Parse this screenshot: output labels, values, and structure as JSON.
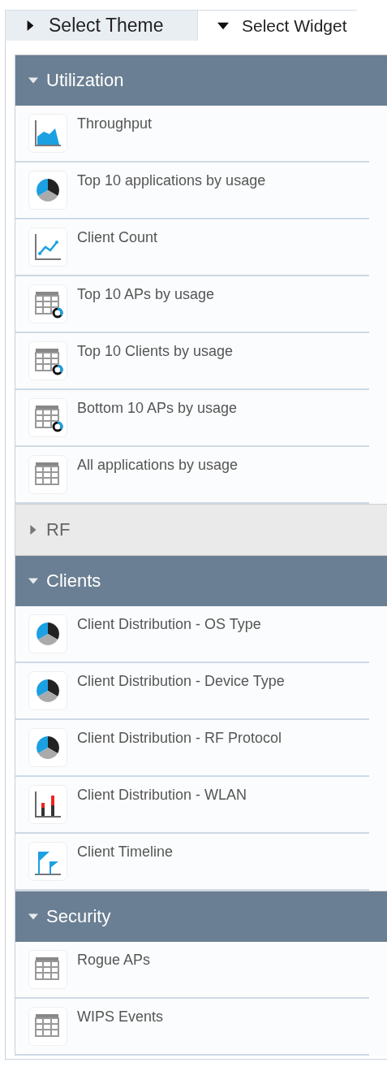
{
  "tabs": [
    {
      "label": "Select Theme",
      "selected": false
    },
    {
      "label": "Select Widget",
      "selected": true
    }
  ],
  "sections": [
    {
      "title": "Utilization",
      "expanded": true,
      "items": [
        {
          "label": "Throughput",
          "kind": "area"
        },
        {
          "label": "Top 10 applications by usage",
          "kind": "pie"
        },
        {
          "label": "Client Count",
          "kind": "line"
        },
        {
          "label": "Top 10 APs by usage",
          "kind": "table-donut"
        },
        {
          "label": "Top 10 Clients by usage",
          "kind": "table-donut"
        },
        {
          "label": "Bottom 10 APs by usage",
          "kind": "table-donut"
        },
        {
          "label": "All applications by usage",
          "kind": "table"
        }
      ]
    },
    {
      "title": "RF",
      "expanded": false
    },
    {
      "title": "Clients",
      "expanded": true,
      "items": [
        {
          "label": "Client Distribution - OS Type",
          "kind": "pie"
        },
        {
          "label": "Client Distribution - Device Type",
          "kind": "pie"
        },
        {
          "label": "Client Distribution - RF Protocol",
          "kind": "pie"
        },
        {
          "label": "Client Distribution - WLAN",
          "kind": "bar"
        },
        {
          "label": "Client Timeline",
          "kind": "flag"
        }
      ]
    },
    {
      "title": "Security",
      "expanded": true,
      "items": [
        {
          "label": "Rogue APs",
          "kind": "table"
        },
        {
          "label": "WIPS Events",
          "kind": "table"
        }
      ]
    }
  ]
}
